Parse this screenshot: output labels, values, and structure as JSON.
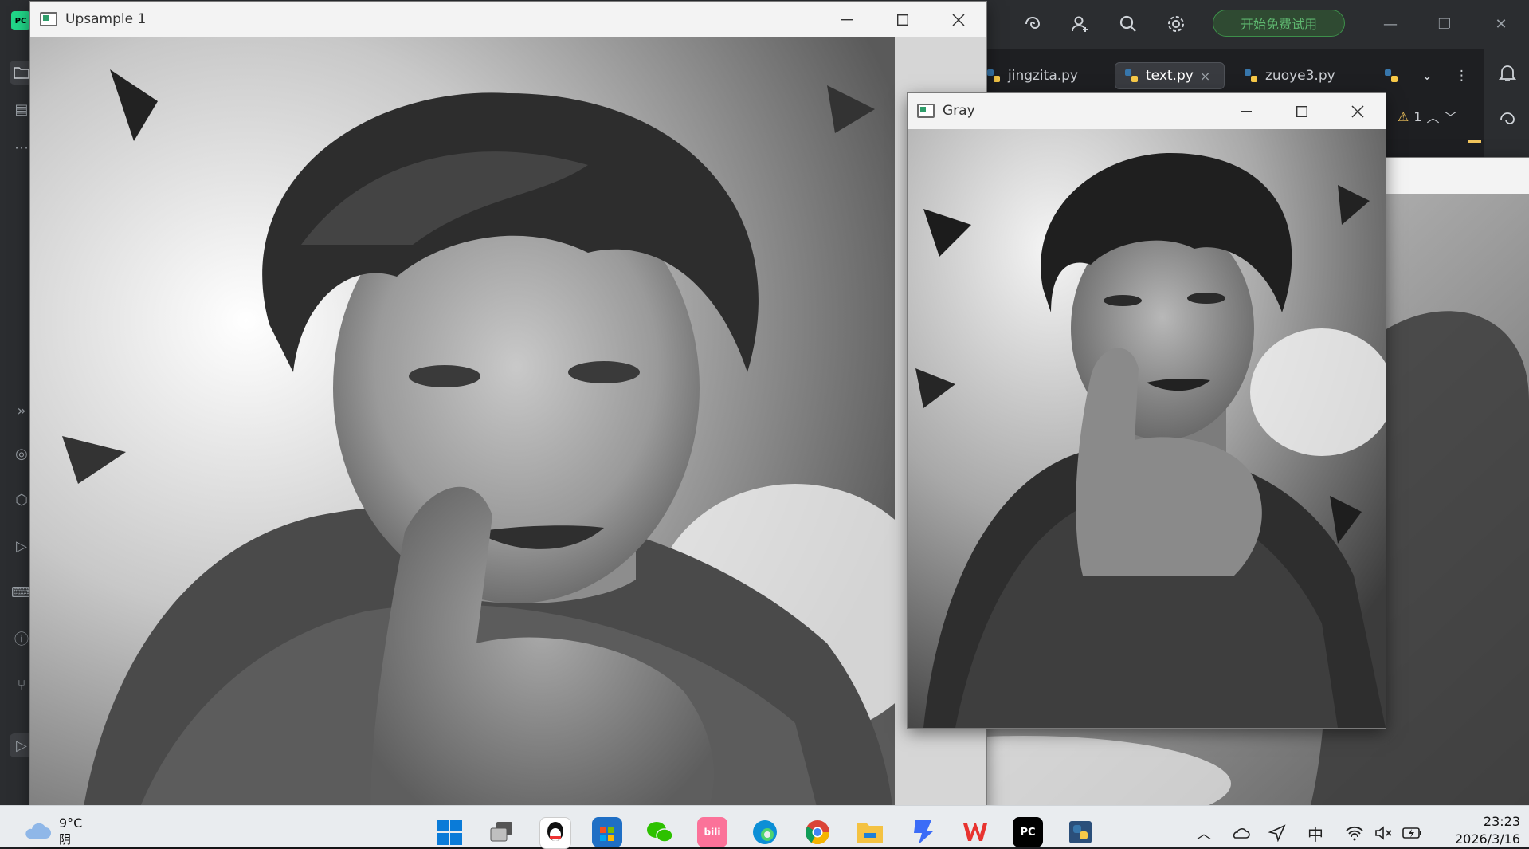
{
  "ide": {
    "trial_button": "开始免费试用",
    "tabs": [
      {
        "label": "jingzita.py",
        "active": false
      },
      {
        "label": "text.py",
        "active": true
      },
      {
        "label": "zuoye3.py",
        "active": false
      }
    ],
    "tab_close": "×",
    "warning_count": "1",
    "logo_text": "PC"
  },
  "windows": {
    "upsample": {
      "title": "Upsample 1"
    },
    "gray": {
      "title": "Gray"
    },
    "background_partial_title": "U"
  },
  "taskbar": {
    "weather_temp": "9°C",
    "weather_cond": "阴",
    "input_method": "中",
    "time": "23:23",
    "date": "2026/3/16",
    "apps": [
      {
        "name": "windows-start",
        "color": "#0078d4"
      },
      {
        "name": "task-view",
        "color": "#6c757d"
      },
      {
        "name": "qq",
        "color": "#111111"
      },
      {
        "name": "microsoft-store",
        "color": "#1f6fc5"
      },
      {
        "name": "wechat",
        "color": "#2dc100"
      },
      {
        "name": "bilibili",
        "color": "#fb7299"
      },
      {
        "name": "edge",
        "color": "#0c8fd6"
      },
      {
        "name": "chrome",
        "color": "#db4437"
      },
      {
        "name": "file-explorer",
        "color": "#f4c242"
      },
      {
        "name": "app-blue",
        "color": "#3b6cf7"
      },
      {
        "name": "wps",
        "color": "#e8332f"
      },
      {
        "name": "pycharm",
        "color": "#21d789"
      },
      {
        "name": "python",
        "color": "#3776ab"
      }
    ],
    "bilibili_label": "bili"
  }
}
